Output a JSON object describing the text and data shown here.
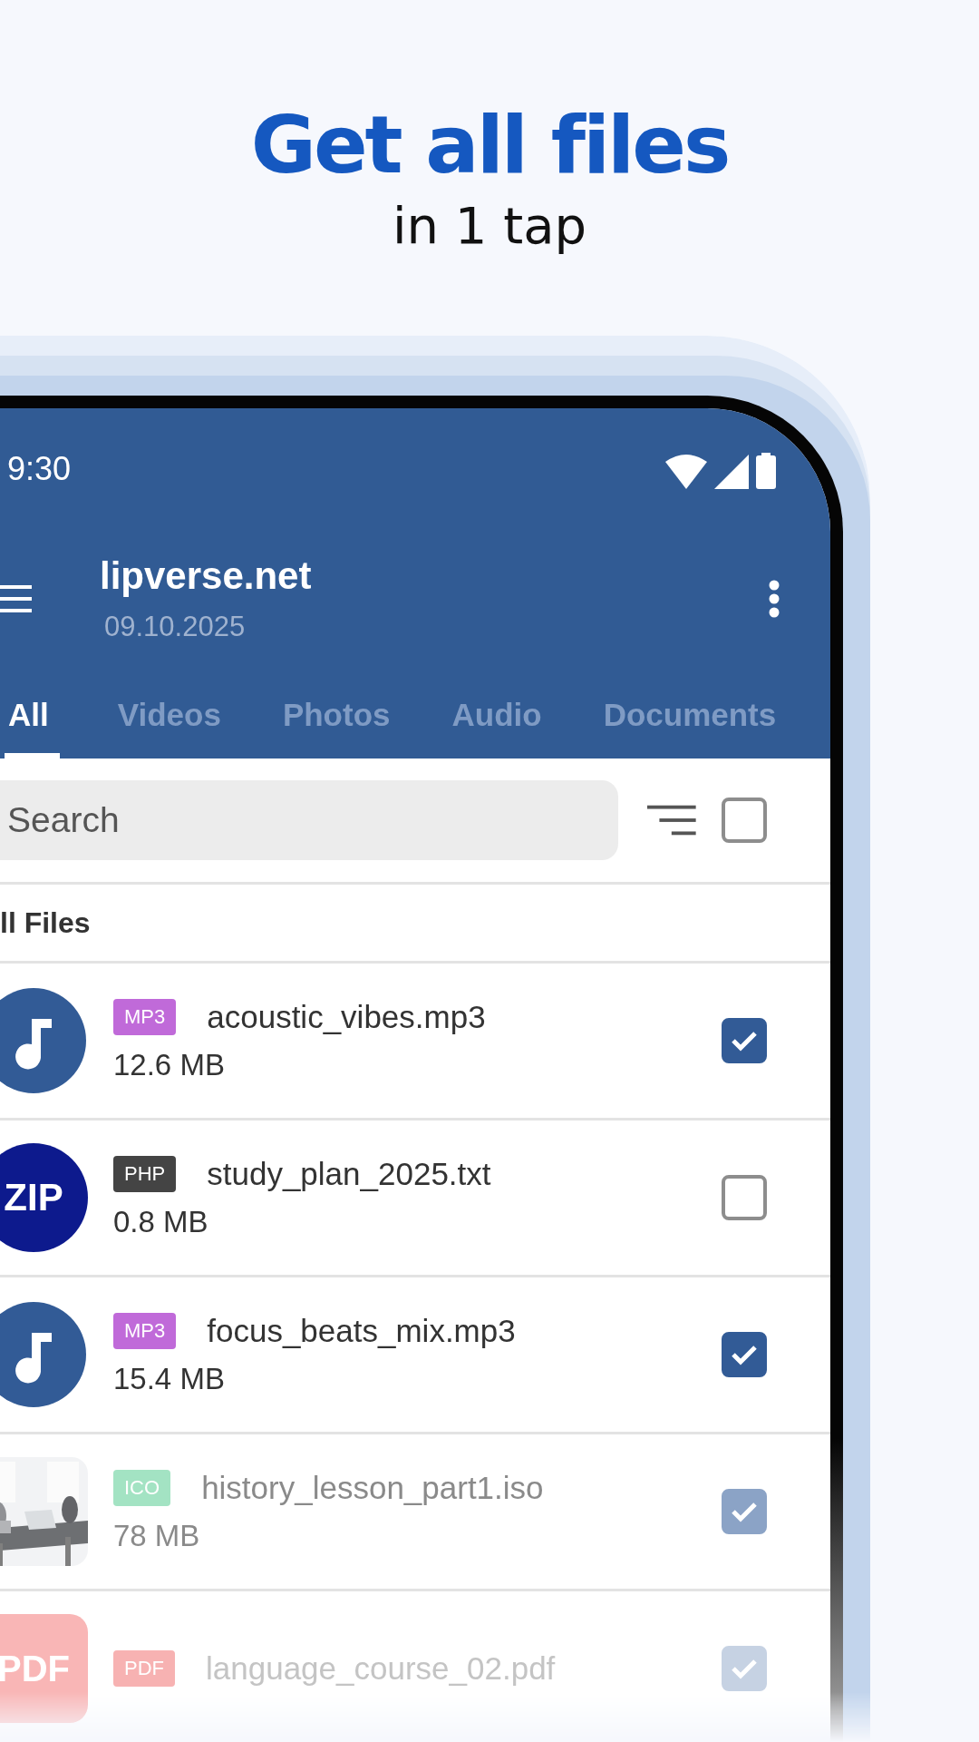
{
  "headline": {
    "title": "Get all files",
    "subtitle": "in 1 tap"
  },
  "status_bar": {
    "time": "9:30"
  },
  "app_bar": {
    "title": "lipverse.net",
    "subtitle": "09.10.2025"
  },
  "tabs": [
    {
      "label": "All",
      "selected": true
    },
    {
      "label": "Videos",
      "selected": false
    },
    {
      "label": "Photos",
      "selected": false
    },
    {
      "label": "Audio",
      "selected": false
    },
    {
      "label": "Documents",
      "selected": false
    }
  ],
  "search": {
    "placeholder": "Search",
    "select_all_checked": false
  },
  "section_title": "ll Files",
  "files": [
    {
      "kind": "music",
      "name": "acoustic_vibes.mp3",
      "badge": "MP3",
      "color": "#c06ad9",
      "size": "12.6 MB",
      "checked": true
    },
    {
      "kind": "zip",
      "avatar_text": "ZIP",
      "name": "study_plan_2025.txt",
      "badge": "PHP",
      "color": "#444444",
      "size": "0.8 MB",
      "checked": false
    },
    {
      "kind": "music",
      "name": "focus_beats_mix.mp3",
      "badge": "MP3",
      "color": "#c06ad9",
      "size": "15.4 MB",
      "checked": true
    },
    {
      "kind": "picture",
      "name": "history_lesson_part1.iso",
      "badge": "ICO",
      "color": "#a3e3c3",
      "size": "78 MB",
      "checked": true
    },
    {
      "kind": "pdf",
      "avatar_text": "PDF",
      "name": "language_course_02.pdf",
      "badge": "PDF",
      "color": "#f7b2b2",
      "checked": true
    }
  ]
}
